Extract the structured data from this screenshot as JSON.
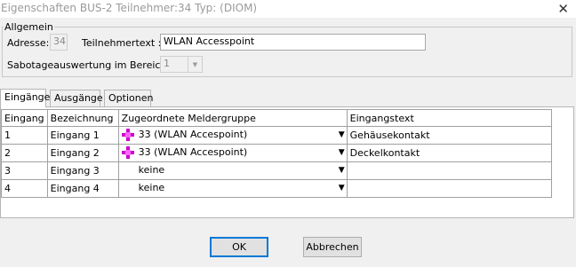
{
  "window": {
    "title": "Eigenschaften BUS-2 Teilnehmer:34 Typ: (DIOM)"
  },
  "general": {
    "group_label": "Allgemein",
    "address_label": "Adresse:",
    "address_value": "34",
    "participant_text_label": "Teilnehmertext :",
    "participant_text_value": "WLAN Accesspoint",
    "sabotage_label": "Sabotageauswertung im Bereich :",
    "sabotage_value": "1"
  },
  "tabs": [
    {
      "label": "Eingänge",
      "active": true
    },
    {
      "label": "Ausgänge",
      "active": false
    },
    {
      "label": "Optionen",
      "active": false
    }
  ],
  "table": {
    "columns": [
      "Eingang",
      "Bezeichnung",
      "Zugeordnete Meldergruppe",
      "Eingangstext"
    ],
    "rows": [
      {
        "nr": "1",
        "name": "Eingang 1",
        "group": "33 (WLAN Accespoint)",
        "has_icon": true,
        "text": "Gehäusekontakt"
      },
      {
        "nr": "2",
        "name": "Eingang 2",
        "group": "33 (WLAN Accespoint)",
        "has_icon": true,
        "text": "Deckelkontakt"
      },
      {
        "nr": "3",
        "name": "Eingang 3",
        "group": "keine",
        "has_icon": false,
        "text": ""
      },
      {
        "nr": "4",
        "name": "Eingang 4",
        "group": "keine",
        "has_icon": false,
        "text": ""
      }
    ]
  },
  "buttons": {
    "ok": "OK",
    "cancel": "Abbrechen"
  },
  "colors": {
    "group_icon": "#cc00cc",
    "default_button_border": "#0078d7"
  },
  "icons": {
    "close": "close-icon",
    "group": "detector-group-icon",
    "dropdown": "chevron-down-icon"
  }
}
